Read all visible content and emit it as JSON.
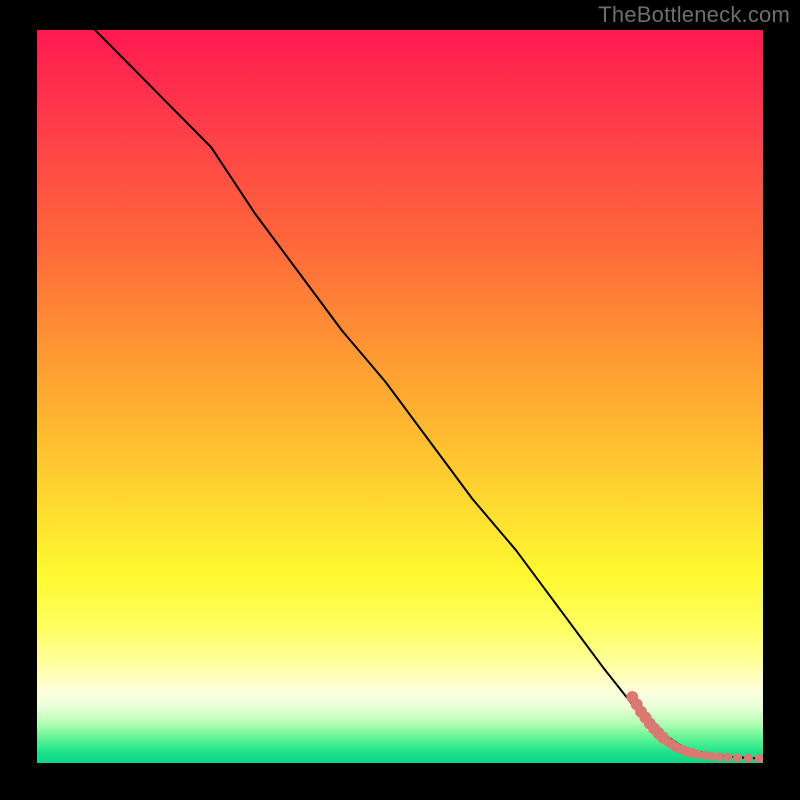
{
  "watermark": "TheBottleneck.com",
  "colors": {
    "frame": "#000000",
    "line": "#000000",
    "marker": "#d97a72",
    "gradient_stops": [
      {
        "offset": 0.0,
        "color": "#ff1a50"
      },
      {
        "offset": 0.12,
        "color": "#ff3a4a"
      },
      {
        "offset": 0.3,
        "color": "#ff6a3a"
      },
      {
        "offset": 0.48,
        "color": "#ffa531"
      },
      {
        "offset": 0.63,
        "color": "#ffd430"
      },
      {
        "offset": 0.74,
        "color": "#fff82f"
      },
      {
        "offset": 0.82,
        "color": "#ffff64"
      },
      {
        "offset": 0.875,
        "color": "#ffffb0"
      },
      {
        "offset": 0.905,
        "color": "#fbffe0"
      },
      {
        "offset": 0.925,
        "color": "#e6ffd6"
      },
      {
        "offset": 0.945,
        "color": "#b6ffb6"
      },
      {
        "offset": 0.965,
        "color": "#66f596"
      },
      {
        "offset": 0.985,
        "color": "#1ee38a"
      },
      {
        "offset": 1.0,
        "color": "#12d486"
      }
    ]
  },
  "chart_data": {
    "type": "line",
    "title": "",
    "xlabel": "",
    "ylabel": "",
    "xlim": [
      0,
      100
    ],
    "ylim": [
      0,
      100
    ],
    "grid": false,
    "series": [
      {
        "name": "curve",
        "style": "line",
        "x": [
          8,
          12,
          18,
          24,
          30,
          36,
          42,
          48,
          54,
          60,
          66,
          72,
          78,
          82,
          85,
          87,
          88.5,
          90,
          92,
          94,
          96,
          98,
          100
        ],
        "values": [
          100,
          96,
          90,
          84,
          75,
          67,
          59,
          52,
          44,
          36,
          29,
          21,
          13,
          8,
          5,
          3.5,
          2.5,
          1.8,
          1.3,
          1.0,
          0.8,
          0.7,
          0.6
        ]
      },
      {
        "name": "markers",
        "style": "scatter",
        "points": [
          {
            "x": 82.0,
            "y": 9.0,
            "r": 6
          },
          {
            "x": 82.6,
            "y": 8.0,
            "r": 6
          },
          {
            "x": 83.2,
            "y": 7.0,
            "r": 6
          },
          {
            "x": 83.8,
            "y": 6.2,
            "r": 6
          },
          {
            "x": 84.4,
            "y": 5.4,
            "r": 6
          },
          {
            "x": 85.0,
            "y": 4.7,
            "r": 6
          },
          {
            "x": 85.6,
            "y": 4.1,
            "r": 6
          },
          {
            "x": 86.2,
            "y": 3.5,
            "r": 6
          },
          {
            "x": 86.8,
            "y": 3.0,
            "r": 5
          },
          {
            "x": 87.4,
            "y": 2.6,
            "r": 5
          },
          {
            "x": 88.0,
            "y": 2.2,
            "r": 5
          },
          {
            "x": 88.7,
            "y": 1.9,
            "r": 5
          },
          {
            "x": 89.4,
            "y": 1.6,
            "r": 5
          },
          {
            "x": 90.2,
            "y": 1.4,
            "r": 5
          },
          {
            "x": 91.0,
            "y": 1.2,
            "r": 4.5
          },
          {
            "x": 92.0,
            "y": 1.05,
            "r": 4.5
          },
          {
            "x": 93.0,
            "y": 0.95,
            "r": 4.5
          },
          {
            "x": 94.0,
            "y": 0.85,
            "r": 4.5
          },
          {
            "x": 95.2,
            "y": 0.78,
            "r": 4.5
          },
          {
            "x": 96.5,
            "y": 0.72,
            "r": 4.5
          },
          {
            "x": 98.0,
            "y": 0.67,
            "r": 4.5
          },
          {
            "x": 99.5,
            "y": 0.63,
            "r": 4.5
          }
        ]
      }
    ]
  }
}
